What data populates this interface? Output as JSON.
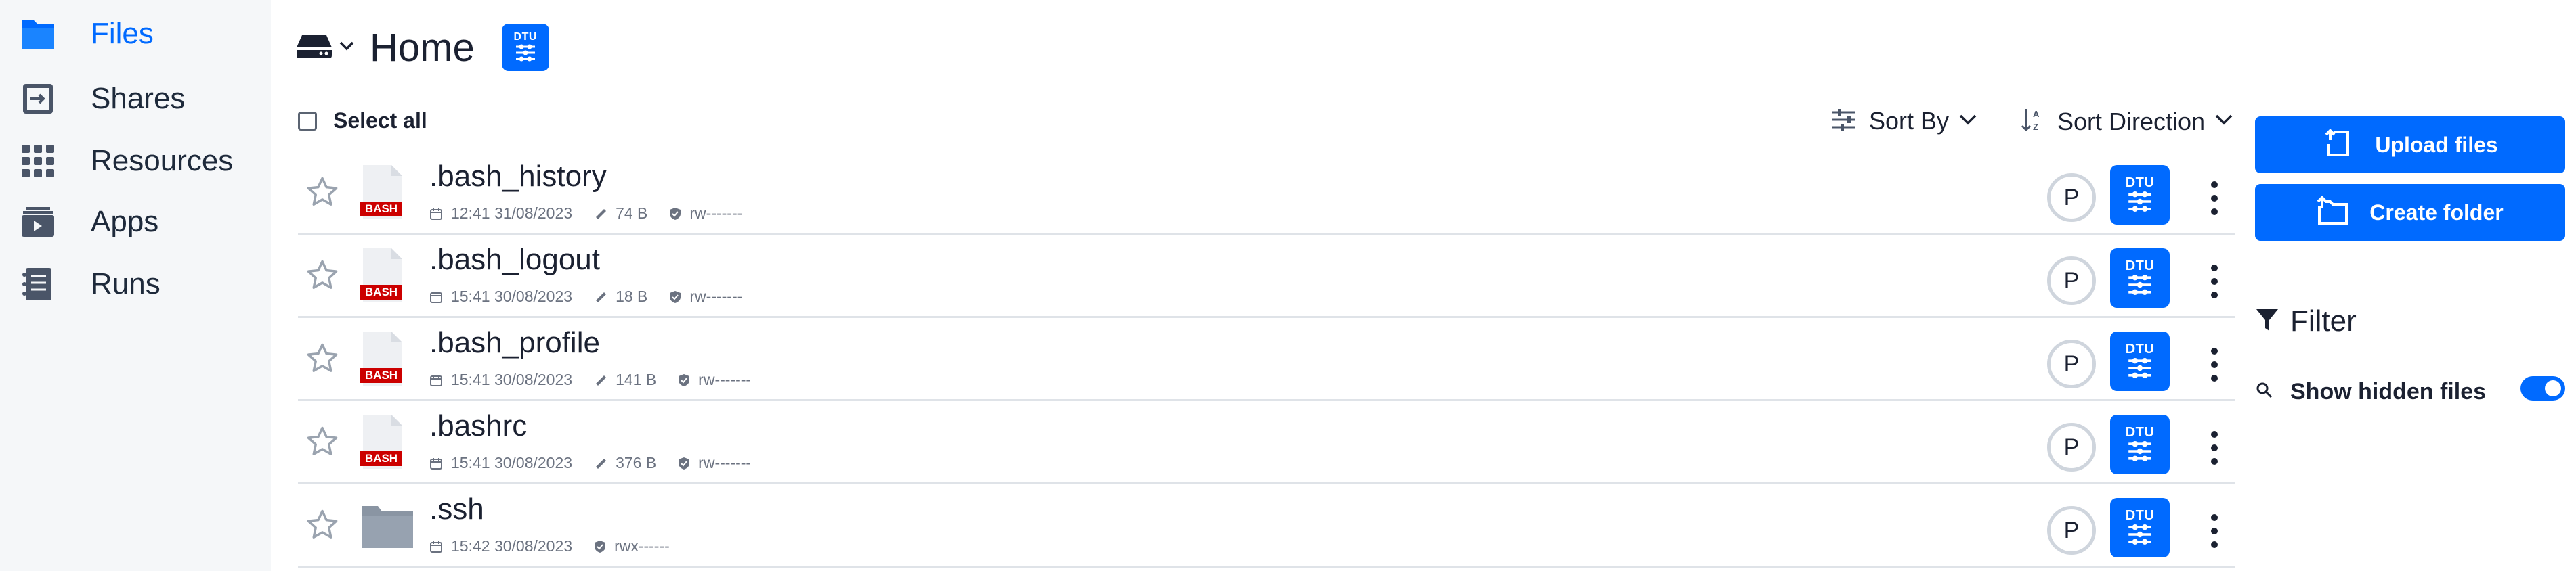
{
  "sidebar": {
    "items": [
      {
        "label": "Files",
        "icon": "folder-icon",
        "active": true
      },
      {
        "label": "Shares",
        "icon": "share-icon",
        "active": false
      },
      {
        "label": "Resources",
        "icon": "grid-icon",
        "active": false
      },
      {
        "label": "Apps",
        "icon": "apps-icon",
        "active": false
      },
      {
        "label": "Runs",
        "icon": "runs-icon",
        "active": false
      }
    ]
  },
  "header": {
    "title": "Home",
    "badge": "DTU"
  },
  "toolbar": {
    "select_all": "Select all",
    "sort_by": "Sort By",
    "sort_direction": "Sort Direction"
  },
  "files": [
    {
      "name": ".bash_history",
      "type_badge": "BASH",
      "modified": "12:41 31/08/2023",
      "size": "74 B",
      "permissions": "rw-------",
      "owner_initial": "P",
      "provider": "DTU",
      "kind": "file"
    },
    {
      "name": ".bash_logout",
      "type_badge": "BASH",
      "modified": "15:41 30/08/2023",
      "size": "18 B",
      "permissions": "rw-------",
      "owner_initial": "P",
      "provider": "DTU",
      "kind": "file"
    },
    {
      "name": ".bash_profile",
      "type_badge": "BASH",
      "modified": "15:41 30/08/2023",
      "size": "141 B",
      "permissions": "rw-------",
      "owner_initial": "P",
      "provider": "DTU",
      "kind": "file"
    },
    {
      "name": ".bashrc",
      "type_badge": "BASH",
      "modified": "15:41 30/08/2023",
      "size": "376 B",
      "permissions": "rw-------",
      "owner_initial": "P",
      "provider": "DTU",
      "kind": "file"
    },
    {
      "name": ".ssh",
      "type_badge": "",
      "modified": "15:42 30/08/2023",
      "size": "",
      "permissions": "rwx------",
      "owner_initial": "P",
      "provider": "DTU",
      "kind": "folder"
    }
  ],
  "actions": {
    "upload": "Upload files",
    "create_folder": "Create folder"
  },
  "filters": {
    "title": "Filter",
    "show_hidden": "Show hidden files",
    "show_hidden_enabled": true
  },
  "colors": {
    "accent": "#006aff",
    "bash_badge": "#cc0000",
    "sidebar_bg": "#f5f7f9"
  }
}
